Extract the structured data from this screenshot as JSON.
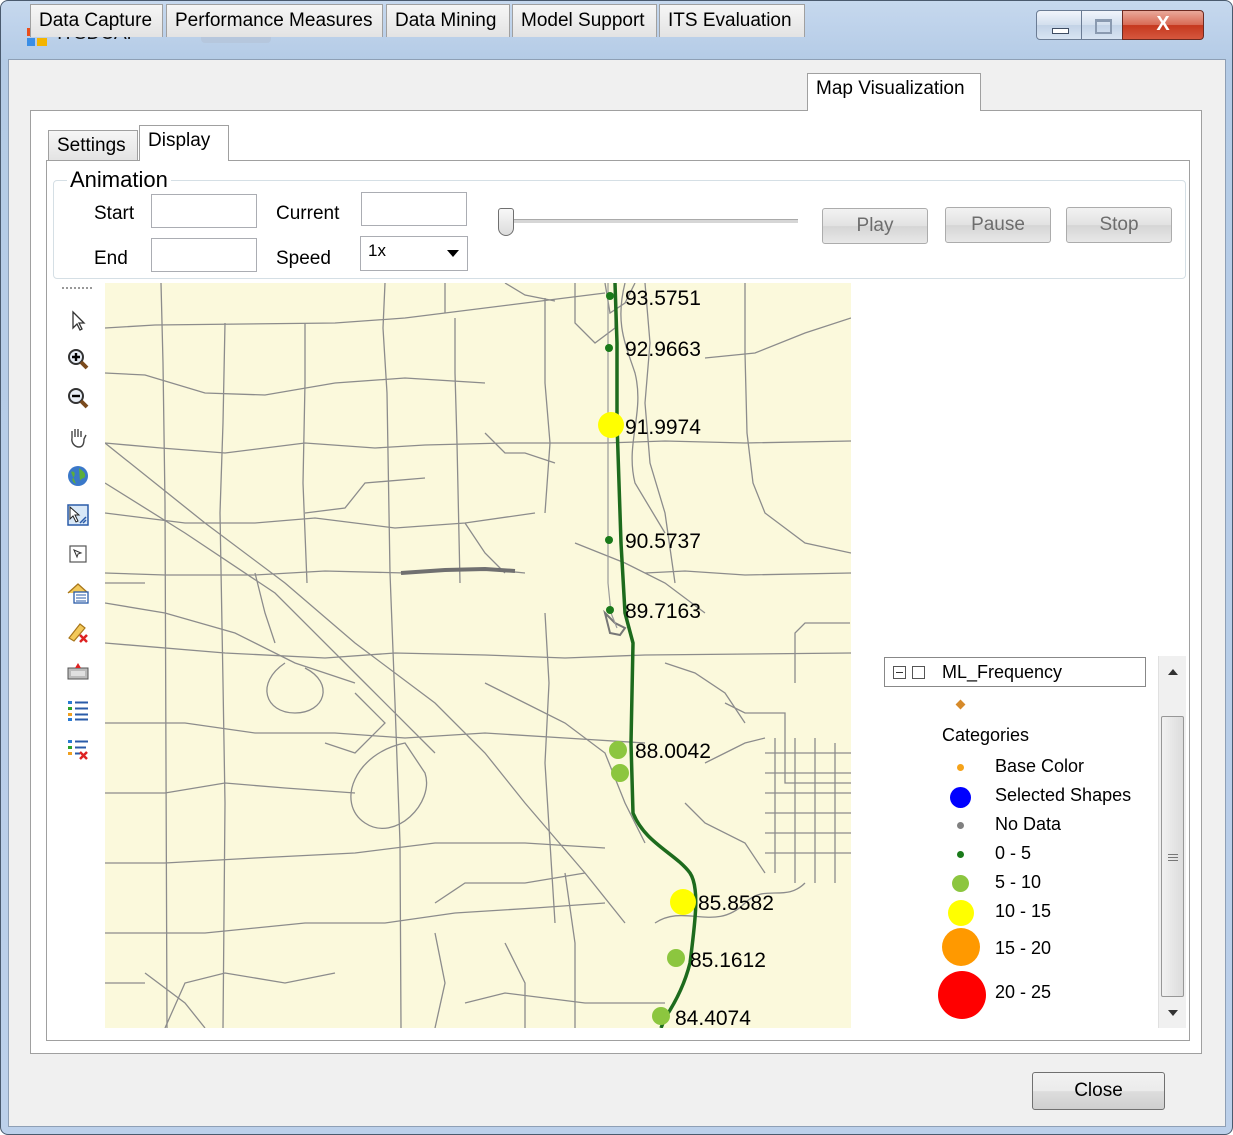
{
  "window": {
    "title": "ITSDCAP",
    "close_glyph": "X"
  },
  "main_tabs": [
    {
      "label": "Data Capture"
    },
    {
      "label": "Performance Measures"
    },
    {
      "label": "Data Mining"
    },
    {
      "label": "Model Support"
    },
    {
      "label": "ITS Evaluation"
    },
    {
      "label": "Map Visualization",
      "active": true
    }
  ],
  "sub_tabs": [
    {
      "label": "Settings"
    },
    {
      "label": "Display",
      "active": true
    }
  ],
  "animation": {
    "group_title": "Animation",
    "start_label": "Start",
    "start_value": "",
    "current_label": "Current",
    "current_value": "",
    "end_label": "End",
    "end_value": "",
    "speed_label": "Speed",
    "speed_value": "1x",
    "slider_position": 0,
    "play_label": "Play",
    "pause_label": "Pause",
    "stop_label": "Stop"
  },
  "map_tools": [
    "select-arrow-icon",
    "zoom-in-icon",
    "zoom-out-icon",
    "pan-hand-icon",
    "globe-full-extent-icon",
    "zoom-to-layer-icon",
    "select-rectangle-icon",
    "add-layer-icon",
    "remove-layer-icon",
    "layer-properties-icon",
    "legend-list-icon",
    "remove-legend-icon"
  ],
  "map": {
    "background": "#fbf9dc",
    "route_color": "#1d6b1d",
    "road_color": "#8c8c8c",
    "markers": [
      {
        "label": "93.5751",
        "category": "0 - 5"
      },
      {
        "label": "92.9663",
        "category": "0 - 5"
      },
      {
        "label": "91.9974",
        "category": "10 - 15"
      },
      {
        "label": "90.5737",
        "category": "0 - 5"
      },
      {
        "label": "89.7163",
        "category": "0 - 5"
      },
      {
        "label": "88.0042",
        "category": "5 - 10"
      },
      {
        "label": "85.8582",
        "category": "10 - 15"
      },
      {
        "label": "85.1612",
        "category": "5 - 10"
      },
      {
        "label": "84.4074",
        "category": "5 - 10"
      }
    ]
  },
  "legend": {
    "layer_name": "ML_Frequency",
    "categories_label": "Categories",
    "items": [
      {
        "label": "Base Color",
        "color": "#f5a31a"
      },
      {
        "label": "Selected Shapes",
        "color": "#0000ff"
      },
      {
        "label": "No Data",
        "color": "#808080"
      },
      {
        "label": "0 - 5",
        "color": "#1a7a1a"
      },
      {
        "label": "5 - 10",
        "color": "#8cc63f"
      },
      {
        "label": "10 - 15",
        "color": "#ffff00"
      },
      {
        "label": "15 - 20",
        "color": "#ff9900"
      },
      {
        "label": "20 - 25",
        "color": "#ff0000"
      }
    ]
  },
  "footer": {
    "close_label": "Close"
  }
}
